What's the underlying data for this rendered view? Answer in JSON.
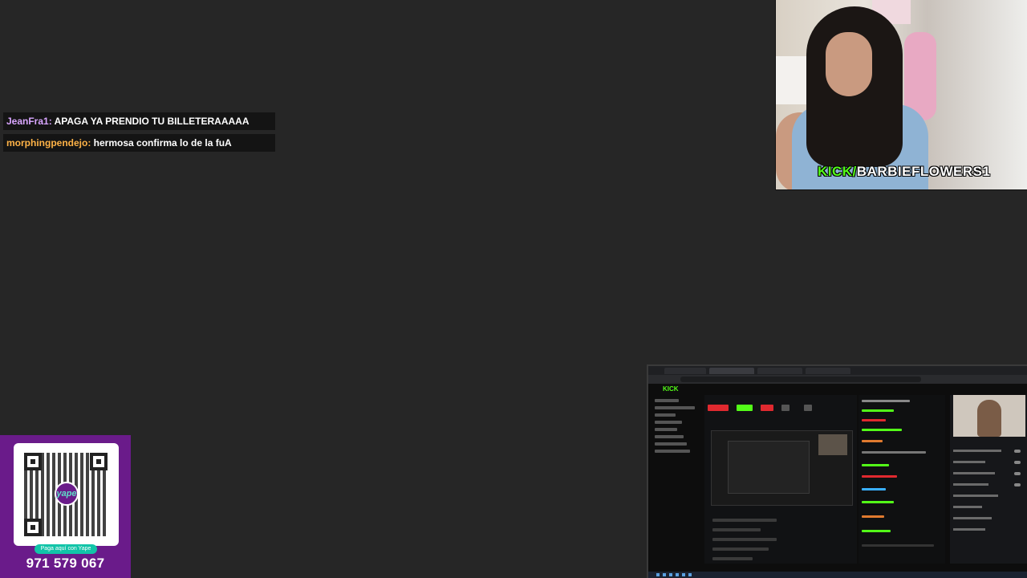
{
  "chat": [
    {
      "user": "JeanFra1",
      "user_color": "#d9a6ff",
      "message": "APAGA YA PRENDIO TU BILLETERAAAAA"
    },
    {
      "user": "morphingpendejo",
      "user_color": "#ffb347",
      "message": "hermosa confirma lo de la fuA"
    }
  ],
  "webcam": {
    "kick_prefix": "KICK/",
    "channel": "BARBIEFLOWERS1",
    "accent": "#53fc18"
  },
  "yape": {
    "logo_text": "yape",
    "pay_label": "Paga aquí con Yape",
    "phone": "971 579 067",
    "brand_color": "#6a1b8a"
  },
  "capture": {
    "logo": "KICK"
  }
}
